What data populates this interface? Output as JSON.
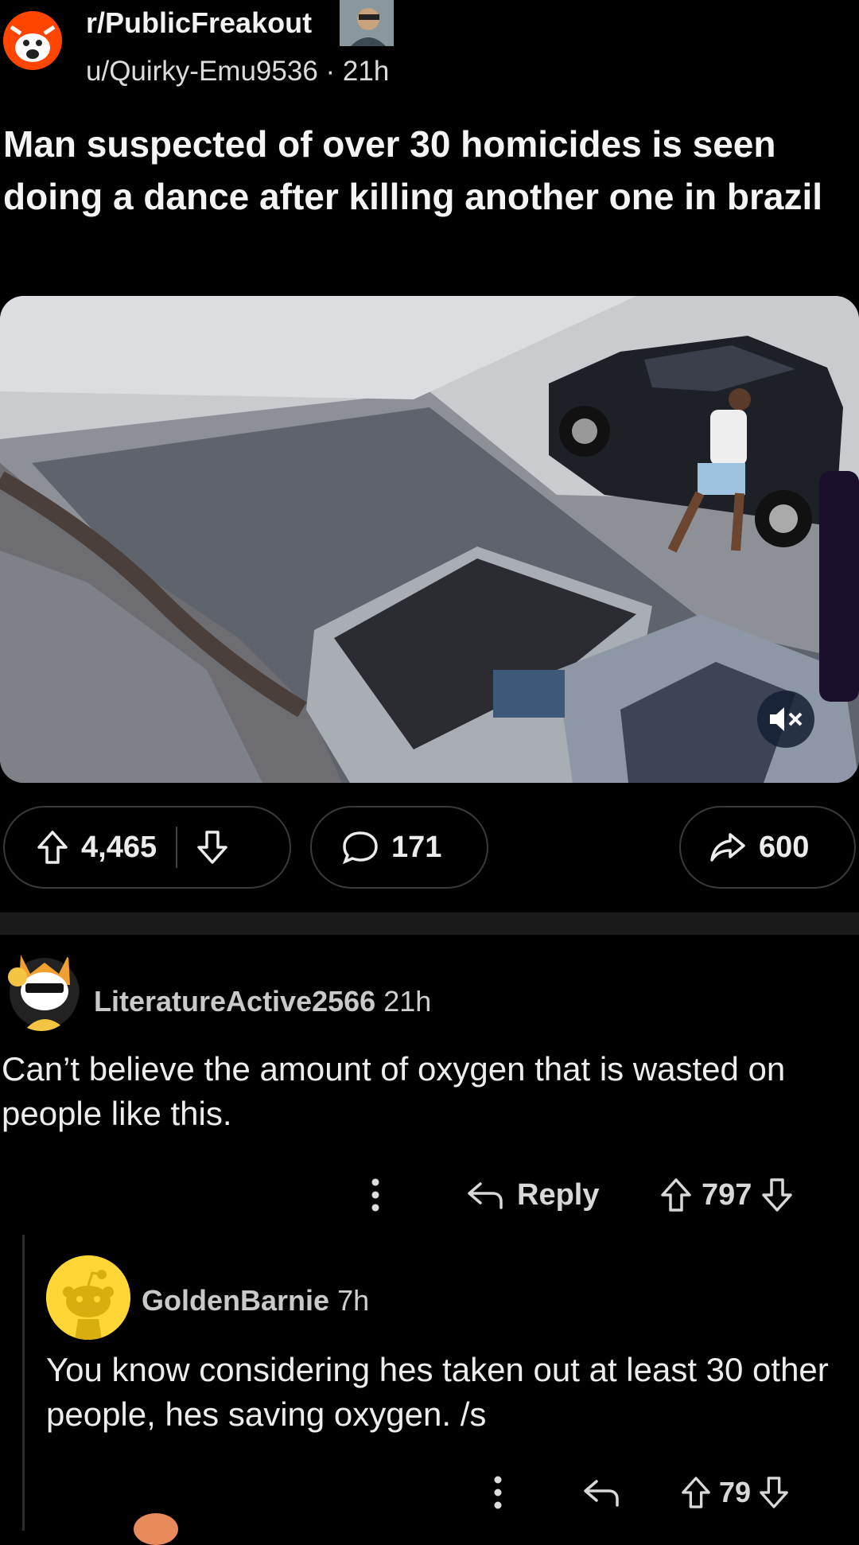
{
  "post": {
    "subreddit": "r/PublicFreakout",
    "author": "u/Quirky-Emu9536",
    "age": "21h",
    "title": "Man suspected of over 30 homicides is seen doing a dance after killing another one in brazil",
    "upvotes": "4,465",
    "comments": "171",
    "shares": "600"
  },
  "comments": [
    {
      "user": "LiteratureActive2566",
      "age": "21h",
      "body": "Can’t believe the amount of oxygen that is wasted on people like this.",
      "reply_label": "Reply",
      "score": "797"
    },
    {
      "user": "GoldenBarnie",
      "age": "7h",
      "body": "You know considering hes taken out at least 30 other people, hes saving oxygen. /s",
      "score": "79"
    }
  ],
  "icons": {
    "subreddit": "subreddit-avatar",
    "upvote": "upvote-arrow-icon",
    "downvote": "downvote-arrow-icon",
    "comment": "comment-bubble-icon",
    "share": "share-arrow-icon",
    "mute": "speaker-muted-icon",
    "reply": "reply-arrow-icon",
    "more": "vertical-dots-icon"
  },
  "colors": {
    "background": "#000000",
    "reddit_orange": "#ff4500",
    "snoo_yellow": "#ffd635"
  }
}
